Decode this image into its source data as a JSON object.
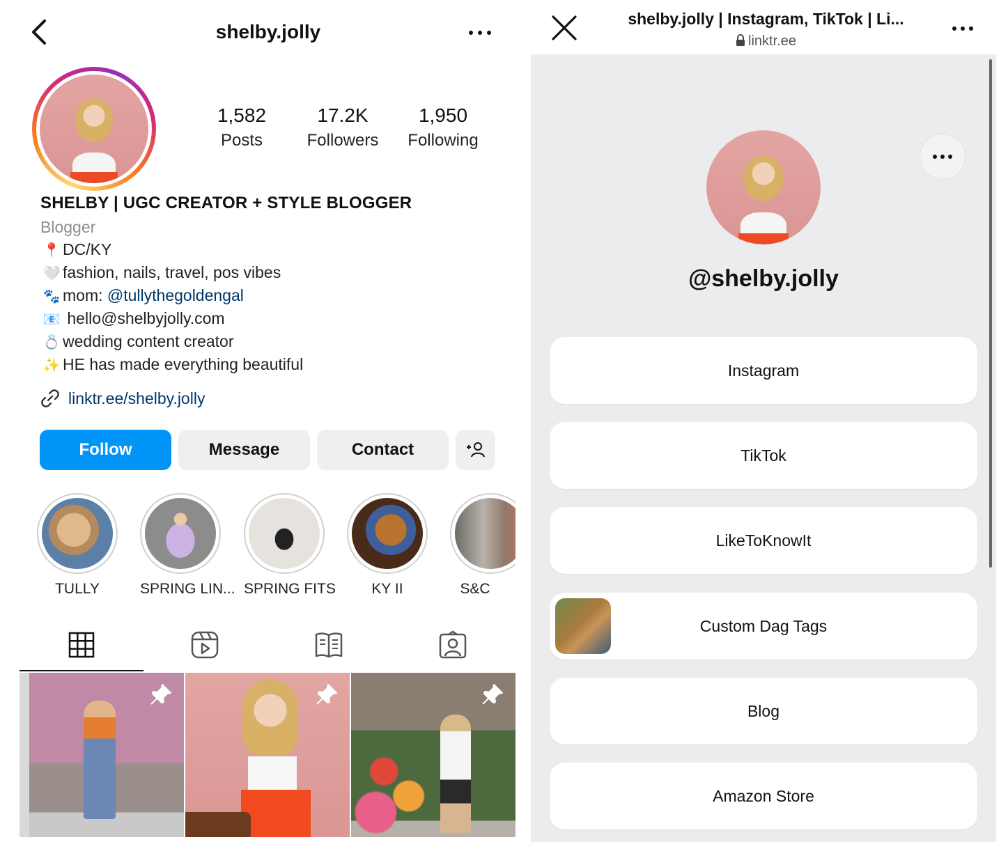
{
  "instagram": {
    "username": "shelby.jolly",
    "stats": [
      {
        "value": "1,582",
        "label": "Posts"
      },
      {
        "value": "17.2K",
        "label": "Followers"
      },
      {
        "value": "1,950",
        "label": "Following"
      }
    ],
    "bio": {
      "name": "SHELBY | UGC CREATOR + STYLE BLOGGER",
      "category": "Blogger",
      "lines": [
        {
          "emoji": "📍",
          "text": "DC/KY"
        },
        {
          "emoji": "🤍",
          "text": "fashion, nails, travel, pos vibes"
        },
        {
          "emoji": "🐾",
          "prefix": "mom: ",
          "mention": "@tullythegoldengal"
        },
        {
          "emoji": "📧",
          "text": "hello@shelbyjolly.com"
        },
        {
          "emoji": "💍",
          "text": "wedding content creator"
        },
        {
          "emoji": "✨",
          "text": "HE has made everything beautiful"
        }
      ],
      "link": "linktr.ee/shelby.jolly"
    },
    "buttons": {
      "follow": "Follow",
      "message": "Message",
      "contact": "Contact"
    },
    "highlights": [
      {
        "name": "TULLY",
        "color": "#c7a27a"
      },
      {
        "name": "SPRING LIN...",
        "color": "#cbb9d9"
      },
      {
        "name": "SPRING FITS",
        "color": "#d9d6d2"
      },
      {
        "name": "KY II",
        "color": "#8b5a2e"
      },
      {
        "name": "S&C",
        "color": "#8a7f78"
      }
    ],
    "tab_icons": [
      "grid-icon",
      "reels-icon",
      "guides-icon",
      "tagged-icon"
    ]
  },
  "linktree": {
    "page_title": "shelby.jolly | Instagram, TikTok | Li...",
    "domain": "linktr.ee",
    "handle": "@shelby.jolly",
    "links": [
      {
        "label": "Instagram",
        "thumb": false
      },
      {
        "label": "TikTok",
        "thumb": false
      },
      {
        "label": "LikeToKnowIt",
        "thumb": false
      },
      {
        "label": "Custom Dag Tags",
        "thumb": true
      },
      {
        "label": "Blog",
        "thumb": false
      },
      {
        "label": "Amazon Store",
        "thumb": false
      }
    ]
  }
}
